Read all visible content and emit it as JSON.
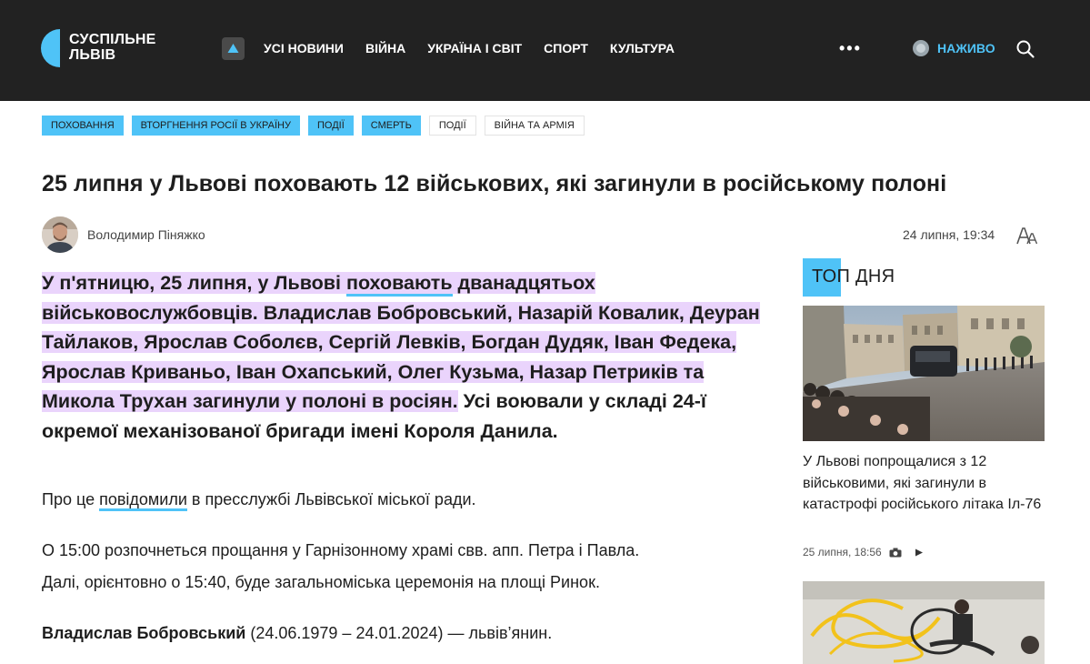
{
  "header": {
    "logo": {
      "line1": "СУСПІЛЬНЕ",
      "line2": "ЛЬВІВ"
    },
    "nav": [
      "УСІ НОВИНИ",
      "ВІЙНА",
      "УКРАЇНА І СВІТ",
      "СПОРТ",
      "КУЛЬТУРА"
    ],
    "more": "•••",
    "live_label": "НАЖИВО"
  },
  "tags": [
    "ПОХОВАННЯ",
    "ВТОРГНЕННЯ РОСІЇ В УКРАЇНУ",
    "ПОДІЇ",
    "СМЕРТЬ",
    "ПОДІЇ",
    "ВІЙНА ТА АРМІЯ"
  ],
  "article": {
    "title": "25 липня у Львові поховають 12 військових, які загинули в російському полоні",
    "author": "Володимир Піняжко",
    "date": "24 липня, 19:34",
    "lead": {
      "part1": "У п'ятницю, 25 липня, у Львові ",
      "link": "поховають",
      "part2": " дванадцятьох військовослужбовців. Владислав Бобровський, Назарій Ковалик, Деуран Тайлаков, Ярослав Соболєв, Сергій Левків, Богдан Дудяк, Іван Федека, Ярослав Криваньо, Іван Охапський, Олег Кузьма, Назар Петриків та Микола Трухан загинули у полоні в росіян.",
      "part3": " Усі воювали у складі 24-ї окремої механізованої бригади імені Короля Данила."
    },
    "p1": {
      "before": "Про це ",
      "link": "повідомили",
      "after": " в пресслужбі Львівської міської ради."
    },
    "p2": "О 15:00 розпочнеться прощання у Гарнізонному храмі свв. апп. Петра і Павла.",
    "p3": "Далі, орієнтовно о 15:40, буде загальноміська церемонія на площі Ринок.",
    "p4": {
      "name": "Владислав Бобровський",
      "rest": " (24.06.1979 – 24.01.2024) — львів’янин."
    }
  },
  "sidebar": {
    "heading": "ТОП ДНЯ",
    "card1": {
      "title": "У Львові попрощалися з 12 військовими, які загинули в катастрофі російського літака Іл-76",
      "date": "25 липня, 18:56"
    }
  },
  "colors": {
    "accent": "#4fc3f7",
    "highlight": "#ead4fc",
    "header_bg": "#222222"
  }
}
